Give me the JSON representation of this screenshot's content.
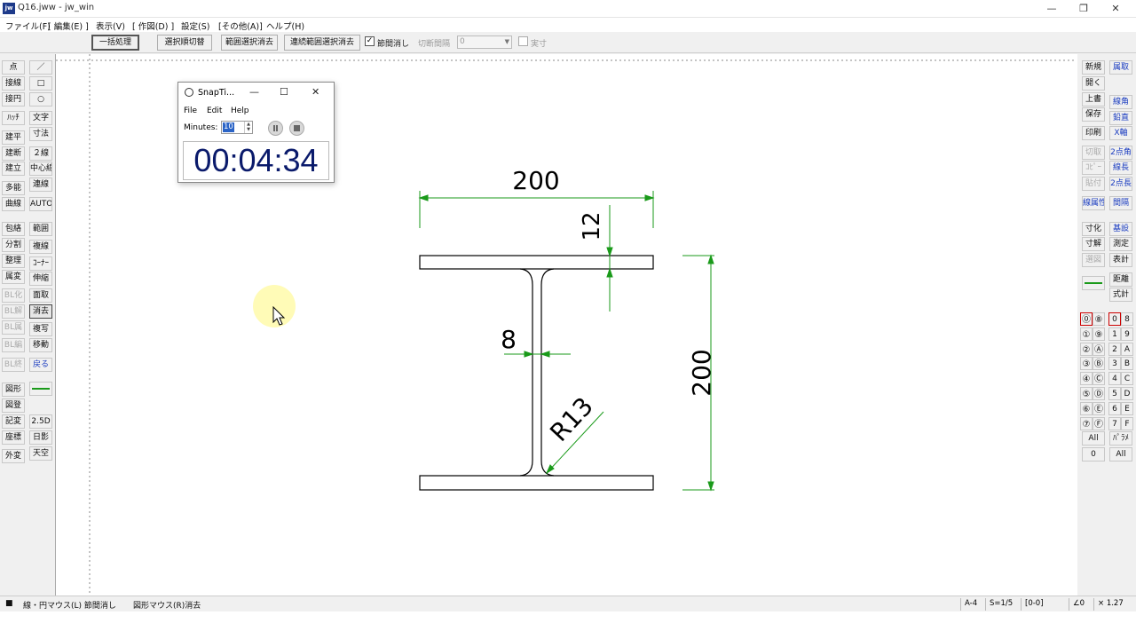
{
  "window": {
    "title": "Q16.jww - jw_win",
    "app_icon": "jw",
    "min": "—",
    "max": "❐",
    "close": "✕"
  },
  "menu": [
    "ファイル(F)",
    "[ 編集(E) ]",
    "表示(V)",
    "[ 作図(D) ]",
    "設定(S)",
    "[その他(A)]",
    "ヘルプ(H)"
  ],
  "toolbar": {
    "b1": "一括処理",
    "b2": "選択順切替",
    "b3": "範囲選択消去",
    "b4": "連続範囲選択消去",
    "chk_label": "節間消し",
    "chk_mark": "✓",
    "cut_label": "切断間隔",
    "cut_value": "0",
    "combo_arrow": "▼",
    "real_label": "実寸"
  },
  "left_col1": [
    "点",
    "接線",
    "接円",
    "ﾊｯﾁ",
    "建平",
    "建断",
    "建立",
    "多能",
    "曲線",
    "包絡",
    "分割",
    "整理",
    "属変",
    "BL化",
    "BL解",
    "BL属",
    "BL編",
    "BL終",
    "図形",
    "図登",
    "記変",
    "座標",
    "外変"
  ],
  "left_col2": [
    "／",
    "□",
    "○",
    "文字",
    "寸法",
    "２線",
    "中心線",
    "連線",
    "AUTO",
    "範囲",
    "複線",
    "ｺｰﾅｰ",
    "伸縮",
    "面取",
    "消去",
    "複写",
    "移動",
    "戻る",
    "2.5D",
    "日影",
    "天空"
  ],
  "right_col1": [
    "新規",
    "開く",
    "上書",
    "保存",
    "印刷",
    "切取",
    "ｺﾋﾟｰ",
    "貼付",
    "線属性",
    "寸化",
    "寸解",
    "選図",
    "All",
    "0"
  ],
  "right_col2": [
    "測定",
    "鉛直",
    "X軸",
    "2点角",
    "線長",
    "2点長",
    "間隔",
    "基設",
    "測定",
    "表計",
    "距離",
    "式計",
    "ﾊﾟﾗﾒ",
    "All",
    "✕"
  ],
  "right_col2_labels": [
    "線角",
    "鉛直",
    "X軸",
    "2点角",
    "線長",
    "2点長",
    "間隔",
    "基設",
    "測定",
    "表計",
    "距離",
    "式計",
    "ﾊﾟﾗﾒ",
    "All",
    "✕"
  ],
  "right_col2_first": "属取",
  "layers_circ": [
    "⓪",
    "①",
    "②",
    "③",
    "④",
    "⑤",
    "⑥",
    "⑦",
    "⑧",
    "⑨",
    "Ⓐ",
    "Ⓑ",
    "Ⓒ",
    "Ⓓ",
    "Ⓔ",
    "Ⓕ"
  ],
  "layers_box": [
    "0",
    "1",
    "2",
    "3",
    "4",
    "5",
    "6",
    "7",
    "8",
    "9",
    "A",
    "B",
    "C",
    "D",
    "E",
    "F"
  ],
  "drawing": {
    "dim_width": "200",
    "dim_flange": "12",
    "dim_web": "8",
    "dim_radius": "R13",
    "dim_height": "200",
    "line_color": "#1a9a1a"
  },
  "snaptimer": {
    "title": "SnapTi...",
    "menu": [
      "File",
      "Edit",
      "Help"
    ],
    "minutes_label": "Minutes:",
    "minutes_value": "10",
    "time": "00:04:34",
    "spin_up": "▲",
    "spin_down": "▼"
  },
  "status": {
    "left_icon": "■",
    "mouse_left": "線・円マウス(L) 節間消し",
    "mouse_right": "図形マウス(R)消去",
    "paper": "A-4",
    "scale": "S=1/5",
    "layer": "[0-0]",
    "angle": "∠0",
    "ratio": "× 1.27"
  }
}
